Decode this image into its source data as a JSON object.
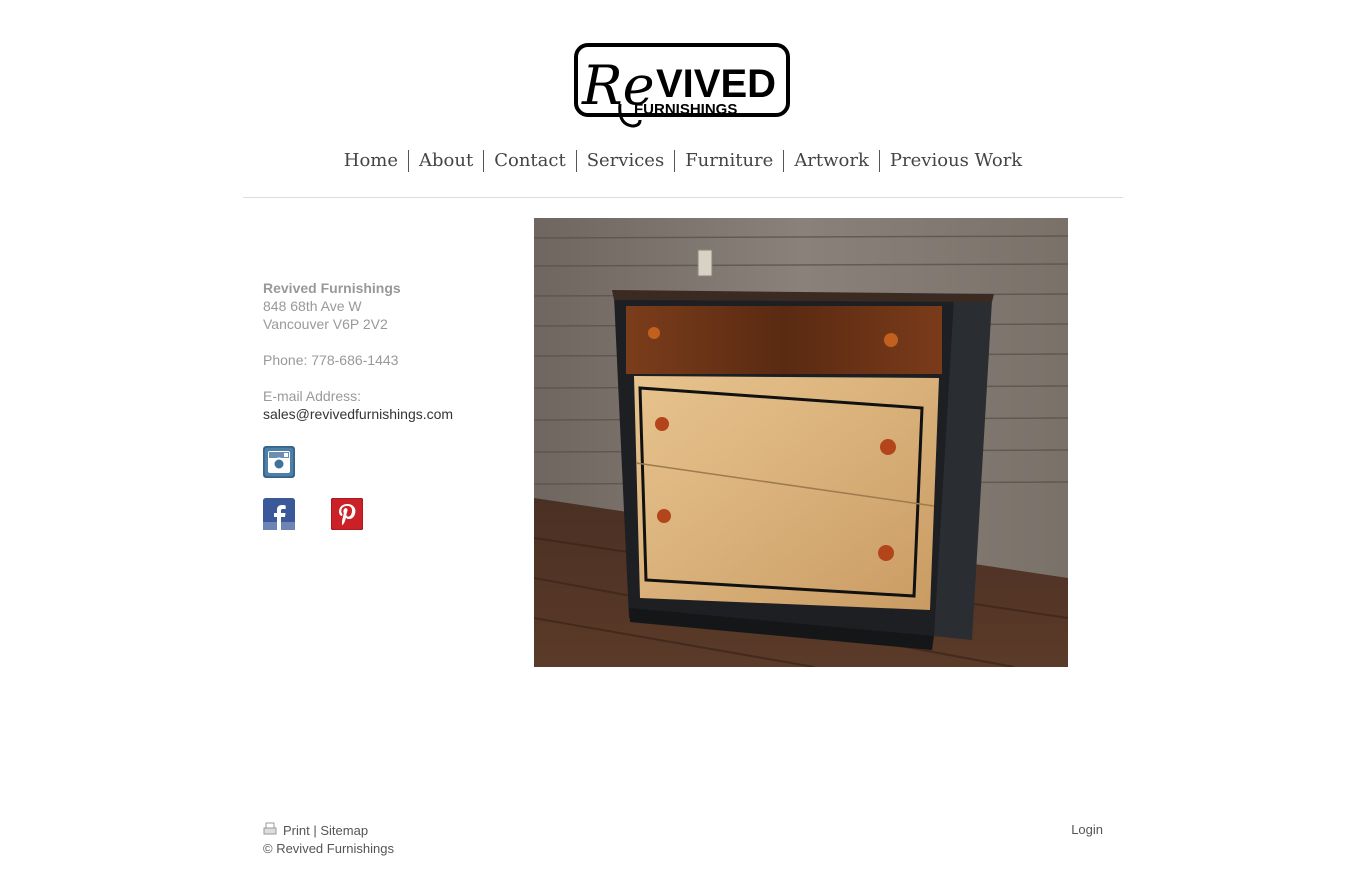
{
  "logo": {
    "alt": "Revived Furnishings",
    "word_re": "Re",
    "word_vived": "VIVED",
    "word_furnishings": "FURNISHINGS"
  },
  "nav": {
    "items": [
      "Home",
      "About",
      "Contact",
      "Services",
      "Furniture",
      "Artwork",
      "Previous Work"
    ]
  },
  "contact": {
    "name": "Revived Furnishings",
    "street": "848 68th Ave W",
    "city": "Vancouver V6P 2V2",
    "phone": "Phone: 778-686-1443",
    "email_label": "E-mail Address:",
    "email": "sales@revivedfurnishings.com"
  },
  "social": {
    "icons": [
      "instagram-icon",
      "facebook-icon",
      "pinterest-icon"
    ],
    "colors": {
      "instagram": "#3f729b",
      "facebook": "#3b5998",
      "pinterest": "#cb2027"
    }
  },
  "footer": {
    "print": "Print",
    "separator": "|",
    "sitemap": "Sitemap",
    "copyright": "© Revived Furnishings",
    "login": "Login"
  }
}
